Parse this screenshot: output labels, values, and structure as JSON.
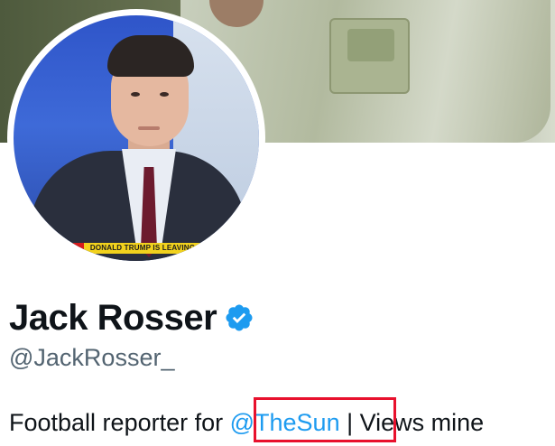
{
  "profile": {
    "name": "Jack Rosser",
    "handle": "@JackRosser_",
    "verified": true,
    "bio_before": "Football reporter for ",
    "bio_mention": "@TheSun",
    "bio_after": " | Views mine"
  },
  "avatar": {
    "ticker_text": "DONALD TRUMP IS LEAVING"
  },
  "icons": {
    "verified": "verified-badge-icon"
  },
  "colors": {
    "verified_blue": "#1d9bf0",
    "mention_blue": "#1d9bf0",
    "highlight_red": "#e8112d",
    "handle_gray": "#536471"
  }
}
